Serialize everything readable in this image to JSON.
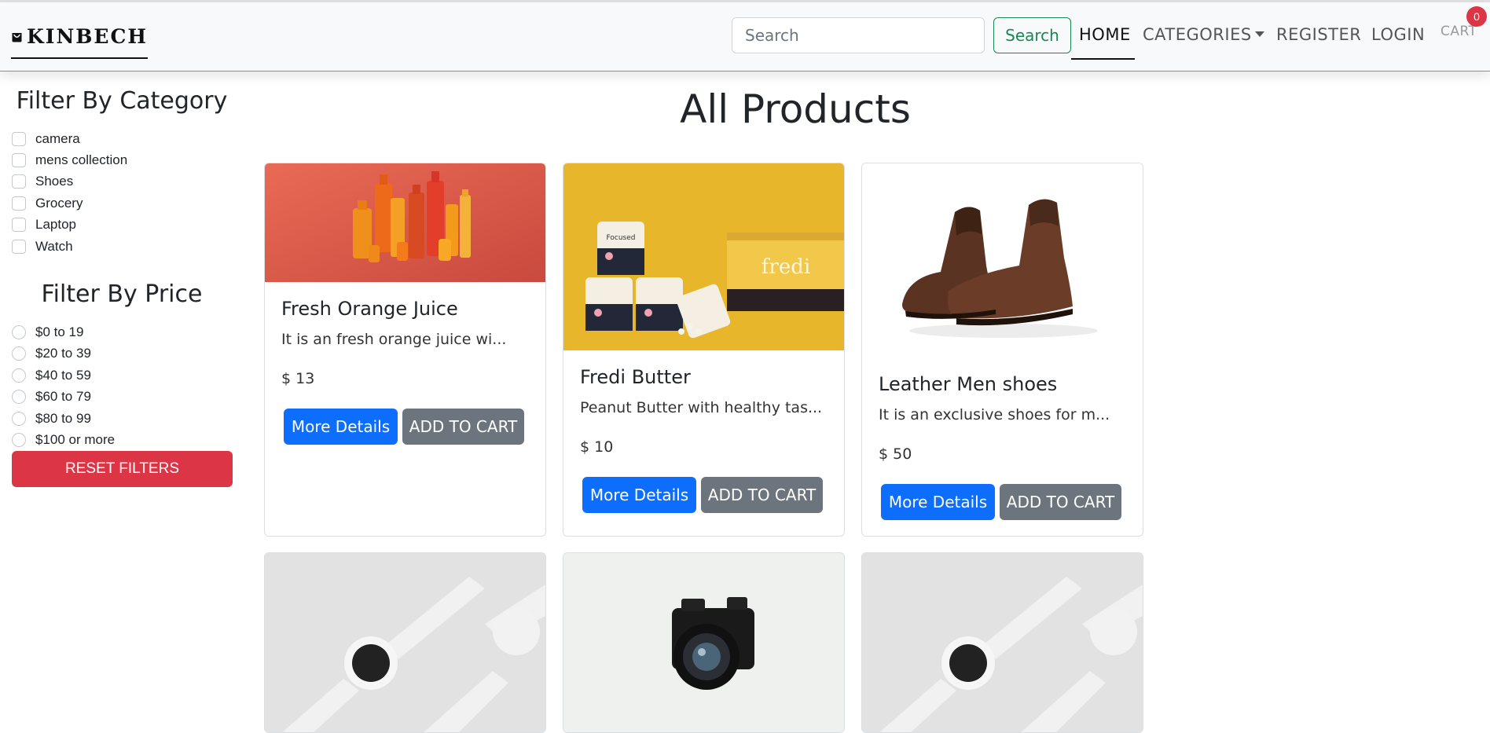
{
  "brand": {
    "name": "KINBECH",
    "icon": "shopping-bag-icon"
  },
  "nav": {
    "search_placeholder": "Search",
    "search_button": "Search",
    "home": "HOME",
    "categories": "CATEGORIES",
    "register": "REGISTER",
    "login": "LOGIN",
    "cart": "CART",
    "cart_count": "0"
  },
  "sidebar": {
    "category_title": "Filter By Category",
    "categories": [
      "camera",
      "mens collection",
      "Shoes",
      "Grocery",
      "Laptop",
      "Watch"
    ],
    "price_title": "Filter By Price",
    "prices": [
      "$0 to 19",
      "$20 to 39",
      "$40 to 59",
      "$60 to 79",
      "$80 to 99",
      "$100 or more"
    ],
    "reset_button": "RESET FILTERS"
  },
  "main": {
    "title": "All Products",
    "products": [
      {
        "title": "Fresh Orange Juice",
        "description": "It is an fresh orange juice wi...",
        "price": "$ 13",
        "details_label": "More Details",
        "cart_label": "ADD TO CART"
      },
      {
        "title": "Fredi Butter",
        "description": "Peanut Butter with healthy tas...",
        "price": "$ 10",
        "details_label": "More Details",
        "cart_label": "ADD TO CART"
      },
      {
        "title": "Leather Men shoes",
        "description": "It is an exclusive shoes for m...",
        "price": "$ 50",
        "details_label": "More Details",
        "cart_label": "ADD TO CART"
      }
    ]
  },
  "product_image_text": {
    "jar": "Focused",
    "box": "fredi"
  },
  "colors": {
    "primary": "#0d6efd",
    "secondary": "#6c757d",
    "danger": "#dc3545",
    "success": "#198754"
  }
}
